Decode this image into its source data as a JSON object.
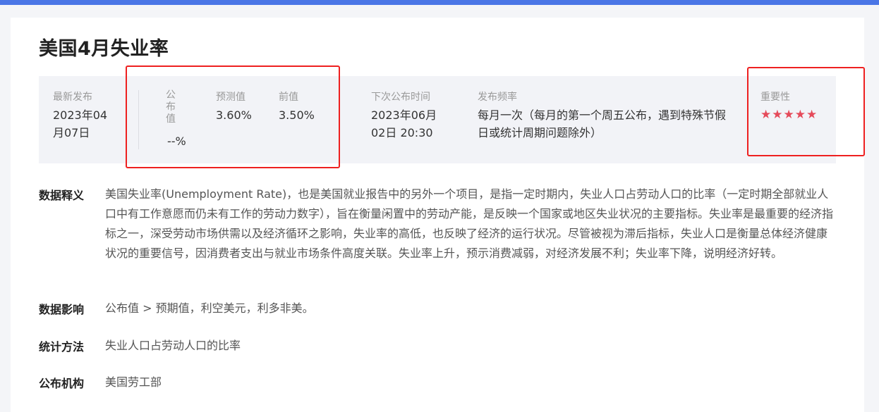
{
  "page": {
    "title": "美国4月失业率"
  },
  "stats": {
    "latest": {
      "label": "最新发布",
      "value": "2023年04月07日"
    },
    "published": {
      "label": "公布值",
      "value": "--%"
    },
    "forecast": {
      "label": "预测值",
      "value": "3.60%"
    },
    "previous": {
      "label": "前值",
      "value": "3.50%"
    },
    "next_release": {
      "label": "下次公布时间",
      "value": "2023年06月02日 20:30"
    },
    "frequency": {
      "label": "发布频率",
      "value": "每月一次（每月的第一个周五公布，遇到特殊节假日或统计周期问题除外）"
    },
    "importance": {
      "label": "重要性",
      "stars": "★★★★★",
      "level": 5,
      "max": 5,
      "color": "#e54a5a"
    }
  },
  "sections": [
    {
      "label": "数据释义",
      "text": "美国失业率(Unemployment Rate)，也是美国就业报告中的另外一个项目，是指一定时期内，失业人口占劳动人口的比率（一定时期全部就业人口中有工作意愿而仍未有工作的劳动力数字），旨在衡量闲置中的劳动产能，是反映一个国家或地区失业状况的主要指标。失业率是最重要的经济指标之一，深受劳动市场供需以及经济循环之影响，失业率的高低，也反映了经济的运行状况。尽管被视为滞后指标，失业人口是衡量总体经济健康状况的重要信号，因消费者支出与就业市场条件高度关联。失业率上升，预示消费减弱，对经济发展不利；失业率下降，说明经济好转。"
    },
    {
      "label": "数据影响",
      "text": "公布值 > 预期值，利空美元，利多非美。"
    },
    {
      "label": "统计方法",
      "text": "失业人口占劳动人口的比率"
    },
    {
      "label": "公布机构",
      "text": "美国劳工部"
    }
  ],
  "colors": {
    "accent": "#4a76e6",
    "highlight_box": "#ee2020"
  }
}
